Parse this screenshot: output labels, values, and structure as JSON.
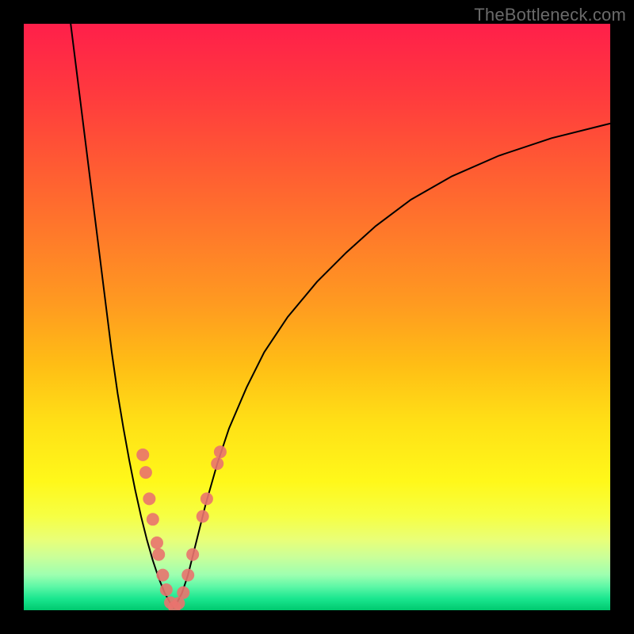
{
  "watermark": "TheBottleneck.com",
  "chart_data": {
    "type": "line",
    "title": "",
    "xlabel": "",
    "ylabel": "",
    "xlim": [
      0,
      100
    ],
    "ylim": [
      0,
      100
    ],
    "grid": false,
    "legend": false,
    "series": [
      {
        "name": "curve-left",
        "x": [
          8,
          9,
          10,
          11,
          12,
          13,
          14,
          15,
          16,
          17,
          18,
          19,
          20,
          21,
          22,
          23,
          24,
          25,
          25.5
        ],
        "y": [
          100,
          92,
          84,
          76,
          68,
          60,
          52,
          44,
          37,
          31,
          25.5,
          20.5,
          16,
          12,
          8.5,
          5.5,
          3,
          1.2,
          0.4
        ]
      },
      {
        "name": "curve-right",
        "x": [
          25.5,
          26,
          27,
          28,
          29,
          30,
          31,
          33,
          35,
          38,
          41,
          45,
          50,
          55,
          60,
          66,
          73,
          81,
          90,
          100
        ],
        "y": [
          0.4,
          1,
          3,
          6,
          10,
          14,
          18,
          25,
          31,
          38,
          44,
          50,
          56,
          61,
          65.5,
          70,
          74,
          77.5,
          80.5,
          83
        ]
      }
    ],
    "markers": {
      "name": "highlight-points",
      "color": "#e9736e",
      "points": [
        {
          "x": 20.3,
          "y": 26.5
        },
        {
          "x": 20.8,
          "y": 23.5
        },
        {
          "x": 21.4,
          "y": 19
        },
        {
          "x": 22.0,
          "y": 15.5
        },
        {
          "x": 22.7,
          "y": 11.5
        },
        {
          "x": 23.0,
          "y": 9.5
        },
        {
          "x": 23.7,
          "y": 6
        },
        {
          "x": 24.3,
          "y": 3.5
        },
        {
          "x": 25.0,
          "y": 1.3
        },
        {
          "x": 25.7,
          "y": 0.5
        },
        {
          "x": 26.4,
          "y": 1.2
        },
        {
          "x": 27.2,
          "y": 3
        },
        {
          "x": 28.0,
          "y": 6
        },
        {
          "x": 28.8,
          "y": 9.5
        },
        {
          "x": 30.5,
          "y": 16
        },
        {
          "x": 31.2,
          "y": 19
        },
        {
          "x": 33.0,
          "y": 25
        },
        {
          "x": 33.5,
          "y": 27
        }
      ]
    }
  }
}
